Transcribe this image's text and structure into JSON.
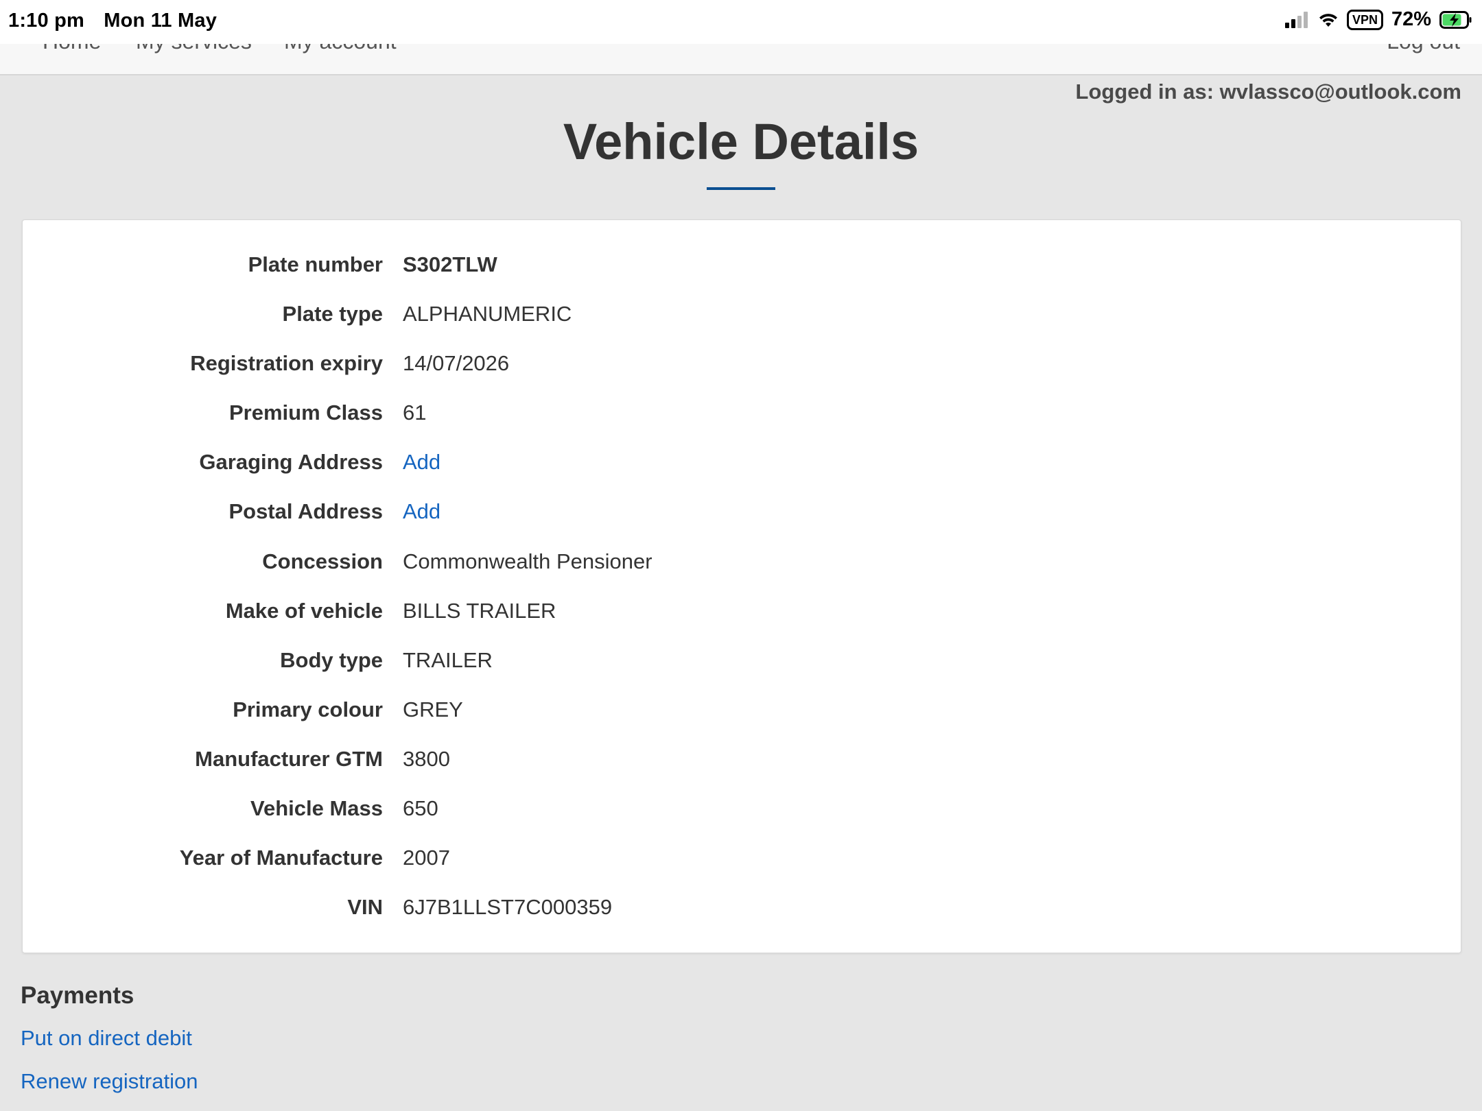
{
  "status_bar": {
    "time": "1:10 pm",
    "date": "Mon 11 May",
    "vpn": "VPN",
    "battery": "72%"
  },
  "nav": {
    "items": [
      "Home",
      "My services",
      "My account"
    ],
    "logout": "Log out"
  },
  "logged_in": "Logged in as: wvlassco@outlook.com",
  "page_title": "Vehicle Details",
  "details": [
    {
      "label": "Plate number",
      "value": "S302TLW"
    },
    {
      "label": "Plate type",
      "value": "ALPHANUMERIC"
    },
    {
      "label": "Registration expiry",
      "value": "14/07/2026"
    },
    {
      "label": "Premium Class",
      "value": "61"
    },
    {
      "label": "Garaging Address",
      "value": "Add"
    },
    {
      "label": "Postal Address",
      "value": "Add"
    },
    {
      "label": "Concession",
      "value": "Commonwealth Pensioner"
    },
    {
      "label": "Make of vehicle",
      "value": "BILLS TRAILER"
    },
    {
      "label": "Body type",
      "value": "TRAILER"
    },
    {
      "label": "Primary colour",
      "value": "GREY"
    },
    {
      "label": "Manufacturer GTM",
      "value": "3800"
    },
    {
      "label": "Vehicle Mass",
      "value": "650"
    },
    {
      "label": "Year of Manufacture",
      "value": "2007"
    },
    {
      "label": "VIN",
      "value": "6J7B1LLST7C000359"
    }
  ],
  "payments": {
    "heading": "Payments",
    "direct_debit": "Put on direct debit",
    "renew": "Renew registration"
  },
  "colors": {
    "accent": "#0b4f91",
    "link": "#1565c0",
    "background": "#e6e6e6"
  },
  "icons": [
    "signal-icon",
    "wifi-icon",
    "battery-charging-icon"
  ]
}
